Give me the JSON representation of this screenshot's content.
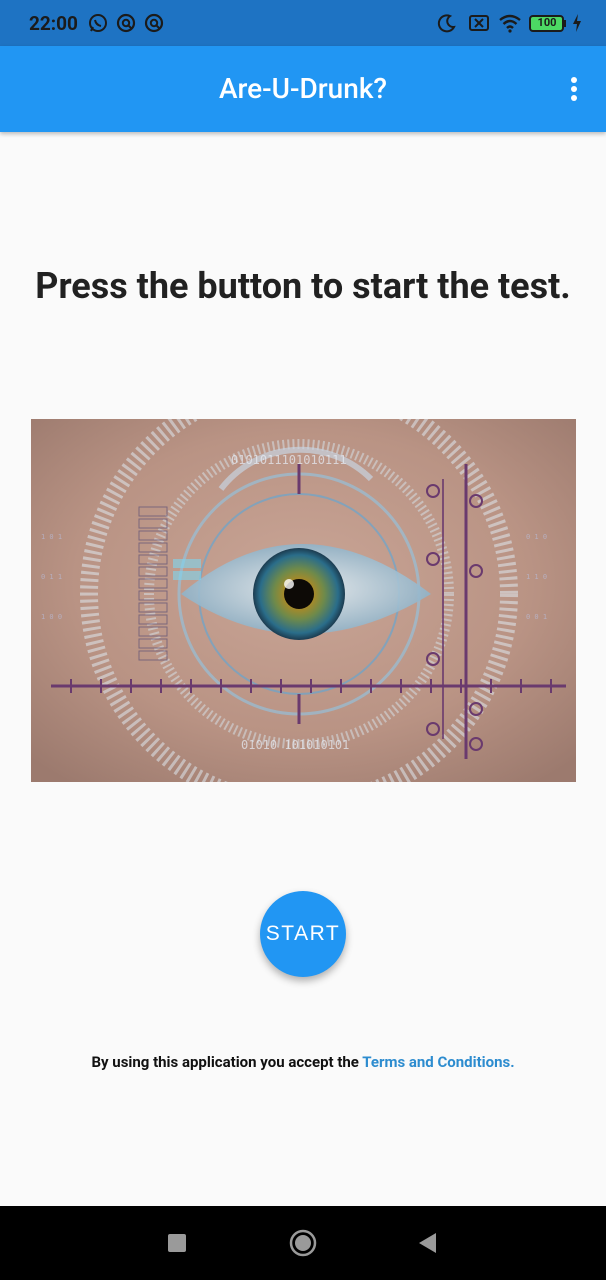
{
  "status_bar": {
    "time": "22:00",
    "battery_level": "100",
    "left_icons": [
      "whatsapp-icon",
      "notification-icon",
      "notification-icon"
    ],
    "right_icons": [
      "moon-icon",
      "sim-off-icon",
      "wifi-icon",
      "battery-icon",
      "charging-icon"
    ]
  },
  "app_bar": {
    "title": "Are-U-Drunk?",
    "menu_icon": "more-vert-icon"
  },
  "main": {
    "headline": "Press the button to start the test.",
    "start_label": "START",
    "terms_prefix": "By using this application you accept the ",
    "terms_link": "Terms and Conditions."
  },
  "nav_bar": {
    "buttons": [
      "recents-icon",
      "home-icon",
      "back-icon"
    ]
  },
  "colors": {
    "app_bar": "#2196f3",
    "status_bar": "#1e73c3",
    "link": "#2d8ccf",
    "battery": "#4cd964"
  }
}
